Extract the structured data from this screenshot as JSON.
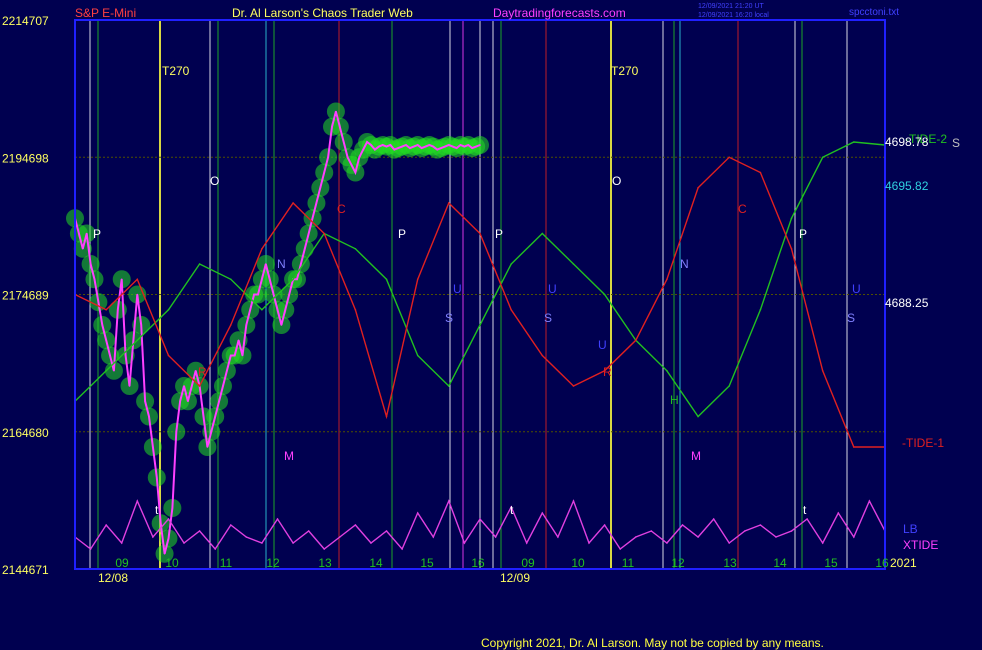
{
  "header": {
    "instrument": "S&P E-Mini",
    "site": "Dr. Al Larson's Chaos Trader Web",
    "url": "Daytradingforecasts.com",
    "timestamp1": "12/09/2021 21:20 UT",
    "timestamp2": "12/09/2021 16:20 local",
    "file": "spcctoni.txt"
  },
  "copyright": "Copyright 2021, Dr. Al Larson. May not be copied by any means.",
  "colors": {
    "background": "#000050",
    "frame": "#2020ff",
    "price": "#ff40ff",
    "blue_ma": "#ff0",
    "cyan_ma": "#30d0e0",
    "white_ma": "#ffffff",
    "tide2": "#20c020",
    "tide1": "#e02020",
    "xtide": "#e040e0",
    "bubbles": "#22dd22"
  },
  "chart_data": {
    "type": "line",
    "ylim": [
      4671,
      4707
    ],
    "y_tick_labels": [
      {
        "left": "221",
        "price": "4707"
      },
      {
        "left": "219",
        "price": "4698"
      },
      {
        "left": "217",
        "price": "4689"
      },
      {
        "left": "216",
        "price": "4680"
      },
      {
        "left": "214",
        "price": "4671"
      }
    ],
    "x_hours": [
      "09",
      "10",
      "11",
      "12",
      "13",
      "14",
      "15",
      "16",
      "09",
      "10",
      "11",
      "12",
      "13",
      "14",
      "15",
      "16"
    ],
    "x_dates": [
      "12/08",
      "12/09"
    ],
    "year": "2021",
    "right_labels": {
      "tide2": "-TIDE-2",
      "tide2_value": "4698.78",
      "s_label": "S",
      "cyan_value": "4695.82",
      "white_value": "4688.25",
      "tide1": "-TIDE-1",
      "lb": "LB",
      "xtide": "XTIDE"
    },
    "markers": {
      "t270": "T270",
      "O": "O",
      "C": "C",
      "P": "P",
      "N": "N",
      "U": "U",
      "S": "S",
      "R": "R",
      "M": "M",
      "H": "H",
      "t": "t"
    },
    "series": [
      {
        "name": "S&P E-Mini",
        "x": [
          0,
          1,
          2,
          3,
          4,
          5,
          6,
          7,
          8,
          9,
          10,
          11,
          12,
          13,
          14,
          15,
          16,
          17,
          18,
          19,
          20,
          21,
          22,
          23,
          24,
          25,
          26,
          27,
          28,
          29,
          30,
          31,
          32,
          33,
          34,
          35,
          36,
          37,
          38,
          39,
          40,
          41,
          42,
          43,
          44,
          45,
          46,
          47,
          48,
          49,
          50,
          51,
          52,
          53,
          54,
          55,
          56,
          57,
          58,
          59,
          60,
          61,
          62,
          63,
          64,
          65,
          66,
          67,
          68,
          69,
          70,
          71,
          72,
          73,
          74,
          75,
          76,
          77,
          78,
          79,
          80,
          81,
          82,
          83,
          84,
          85,
          86,
          87,
          88,
          89,
          90,
          91,
          92,
          93,
          94,
          95,
          96,
          97,
          98,
          99,
          100,
          101,
          102,
          103,
          104
        ],
        "y": [
          4694,
          4693,
          4692,
          4693,
          4691,
          4690,
          4688.5,
          4687,
          4686,
          4685,
          4684,
          4688,
          4690,
          4685,
          4683,
          4686,
          4689,
          4687,
          4682,
          4681,
          4679,
          4677,
          4674,
          4672,
          4673,
          4675,
          4680,
          4682,
          4683,
          4682,
          4683,
          4684,
          4683,
          4681,
          4679,
          4680,
          4681,
          4682,
          4683,
          4684,
          4685,
          4685,
          4686,
          4685,
          4687,
          4688,
          4689,
          4689,
          4690,
          4691,
          4690,
          4689,
          4688,
          4687,
          4688,
          4689,
          4690,
          4690,
          4691,
          4692,
          4693,
          4694,
          4695,
          4696,
          4697,
          4698,
          4700,
          4701,
          4700,
          4699,
          4698,
          4697.5,
          4697,
          4698,
          4698.5,
          4699,
          4698.8,
          4698.5,
          4698.7,
          4698.8,
          4698.7,
          4698.8,
          4698.5,
          4698.6,
          4698.7,
          4698.8,
          4698.6,
          4698.7,
          4698.8,
          4698.6,
          4698.7,
          4698.8,
          4698.7,
          4698.5,
          4698.6,
          4698.7,
          4698.8,
          4698.7,
          4698.6,
          4698.8,
          4698.7,
          4698.8,
          4698.6,
          4698.7,
          4698.8
        ]
      },
      {
        "name": "TIDE-2",
        "x": [
          0,
          8,
          16,
          24,
          32,
          40,
          48,
          56,
          64,
          72,
          80,
          88,
          96,
          104,
          112,
          120,
          128,
          136,
          144,
          152,
          160,
          168,
          176,
          184,
          192,
          200,
          208
        ],
        "y": [
          4682,
          4684,
          4686,
          4688,
          4691,
          4690,
          4688,
          4690,
          4693,
          4692,
          4690,
          4685,
          4683,
          4687,
          4691,
          4693,
          4691,
          4689,
          4686,
          4684,
          4681,
          4683,
          4688,
          4694,
          4698,
          4699,
          4698.8
        ]
      },
      {
        "name": "TIDE-1",
        "x": [
          0,
          8,
          16,
          24,
          32,
          40,
          48,
          56,
          64,
          72,
          80,
          88,
          96,
          104,
          112,
          120,
          128,
          136,
          144,
          152,
          160,
          168,
          176,
          184,
          192,
          200,
          208
        ],
        "y": [
          4689,
          4688,
          4690,
          4685,
          4683,
          4687,
          4692,
          4695,
          4693,
          4688,
          4681,
          4690,
          4695,
          4693,
          4688,
          4685,
          4683,
          4684,
          4686,
          4690,
          4696,
          4698,
          4697,
          4692,
          4684,
          4679,
          4679
        ]
      },
      {
        "name": "XTIDE",
        "x": [
          0,
          4,
          8,
          12,
          16,
          20,
          24,
          28,
          32,
          36,
          40,
          44,
          48,
          52,
          56,
          60,
          64,
          68,
          72,
          76,
          80,
          84,
          88,
          92,
          96,
          100,
          104,
          108,
          112,
          116,
          120,
          124,
          128,
          132,
          136,
          140,
          144,
          148,
          152,
          156,
          160,
          164,
          168,
          172,
          176,
          180,
          184,
          188,
          192,
          196,
          200,
          204,
          208
        ],
        "y": [
          0.3,
          0.1,
          0.5,
          0.2,
          0.9,
          0.3,
          0.6,
          0.2,
          0.4,
          0.1,
          0.5,
          0.3,
          0.2,
          0.6,
          0.2,
          0.4,
          0.1,
          0.3,
          0.5,
          0.2,
          0.4,
          0.1,
          0.7,
          0.3,
          0.9,
          0.2,
          0.6,
          0.3,
          0.8,
          0.2,
          0.7,
          0.3,
          0.9,
          0.2,
          0.5,
          0.1,
          0.3,
          0.4,
          0.2,
          0.5,
          0.3,
          0.6,
          0.2,
          0.4,
          0.5,
          0.3,
          0.4,
          0.6,
          0.2,
          0.7,
          0.3,
          0.9,
          0.4
        ]
      }
    ]
  }
}
